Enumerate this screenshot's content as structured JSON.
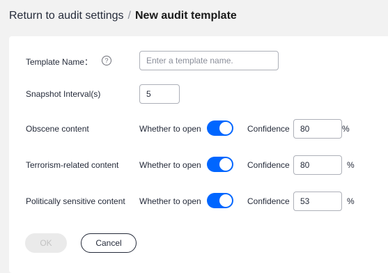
{
  "breadcrumb": {
    "back_label": "Return to audit settings",
    "separator": "/",
    "current": "New audit template"
  },
  "form": {
    "template_name": {
      "label": "Template Name：",
      "placeholder": "Enter a template name.",
      "value": ""
    },
    "snapshot_interval": {
      "label": "Snapshot Interval(s)",
      "value": "5"
    },
    "rows": [
      {
        "label": "Obscene content",
        "open_label": "Whether to open",
        "enabled": true,
        "confidence_label": "Confidence",
        "confidence": "80",
        "unit": "%"
      },
      {
        "label": "Terrorism-related content",
        "open_label": "Whether to open",
        "enabled": true,
        "confidence_label": "Confidence",
        "confidence": "80",
        "unit": "%"
      },
      {
        "label": "Politically sensitive content",
        "open_label": "Whether to open",
        "enabled": true,
        "confidence_label": "Confidence",
        "confidence": "53",
        "unit": "%"
      }
    ]
  },
  "buttons": {
    "ok_label": "OK",
    "cancel_label": "Cancel"
  },
  "icons": {
    "help": "question-circle-icon"
  },
  "colors": {
    "toggle_on": "#0066ff",
    "page_bg": "#f2f2f2"
  }
}
